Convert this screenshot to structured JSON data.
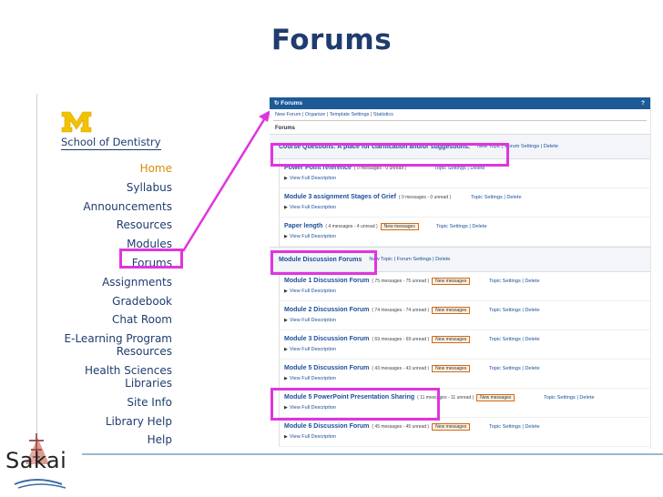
{
  "slide": {
    "title": "Forums"
  },
  "school": {
    "logo_letter": "M",
    "name": "School of Dentistry"
  },
  "nav": [
    {
      "label": "Home"
    },
    {
      "label": "Syllabus"
    },
    {
      "label": "Announcements"
    },
    {
      "label": "Resources"
    },
    {
      "label": "Modules"
    },
    {
      "label": "Forums"
    },
    {
      "label": "Assignments"
    },
    {
      "label": "Gradebook"
    },
    {
      "label": "Chat Room"
    },
    {
      "label": "E-Learning Program"
    },
    {
      "label": "Resources"
    },
    {
      "label": "Health Sciences"
    },
    {
      "label": "Libraries"
    },
    {
      "label": "Site Info"
    },
    {
      "label": "Library Help"
    },
    {
      "label": "Help"
    }
  ],
  "panel": {
    "header_title": "Forums",
    "help_mark": "?",
    "toolbar": [
      "New Forum",
      "Organize",
      "Template Settings",
      "Statistics"
    ],
    "toolbar_sep": "|",
    "heading": "Forums",
    "forum_actions": [
      "New Topic",
      "Forum Settings",
      "Delete"
    ],
    "topic_actions": [
      "Topic Settings",
      "Delete"
    ],
    "view_desc": "View Full Description",
    "new_messages": "New messages",
    "forums": [
      {
        "title": "Course Questions: A place for clarification and/or suggestions.",
        "topics": [
          {
            "title": "Power Point reference",
            "counts": "( 0 messages - 0 unread )"
          },
          {
            "title": "Module 3 assignment Stages of Grief",
            "counts": "( 0 messages - 0 unread )"
          },
          {
            "title": "Paper length",
            "counts": "( 4 messages - 4 unread )"
          }
        ]
      },
      {
        "title": "Module Discussion Forums",
        "topics": [
          {
            "title": "Module 1 Discussion Forum",
            "counts": "( 75 messages - 75 unread )"
          },
          {
            "title": "Module 2 Discussion Forum",
            "counts": "( 74 messages - 74 unread )"
          },
          {
            "title": "Module 3 Discussion Forum",
            "counts": "( 69 messages - 69 unread )"
          },
          {
            "title": "Module 5 Discussion Forum",
            "counts": "( 43 messages - 43 unread )"
          },
          {
            "title": "Module 5 PowerPoint Presentation Sharing",
            "counts": "( 11 messages - 11 unread )"
          },
          {
            "title": "Module 6 Discussion Forum",
            "counts": "( 45 messages - 45 unread )"
          }
        ]
      }
    ]
  },
  "brand": {
    "name": "Sakai"
  },
  "colors": {
    "navy": "#1f3c6e",
    "home": "#d98a00",
    "highlight": "#e034e0",
    "header": "#1d5a98",
    "badge_border": "#d06a1a"
  }
}
